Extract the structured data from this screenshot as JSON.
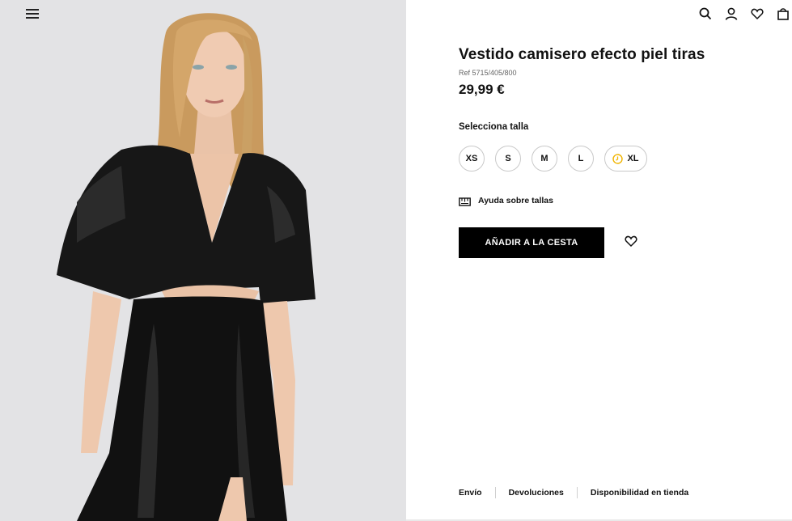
{
  "header": {
    "menu_icon": "hamburger-menu-icon",
    "icons": [
      "search-icon",
      "user-icon",
      "heart-icon",
      "bag-icon"
    ]
  },
  "product": {
    "title": "Vestido camisero efecto piel tiras",
    "ref": "Ref 5715/405/800",
    "price": "29,99 €",
    "image_alt_icon": "product-photo"
  },
  "sizes": {
    "label": "Selecciona talla",
    "options": [
      {
        "label": "XS",
        "low_stock": false
      },
      {
        "label": "S",
        "low_stock": false
      },
      {
        "label": "M",
        "low_stock": false
      },
      {
        "label": "L",
        "low_stock": false
      },
      {
        "label": "XL",
        "low_stock": true
      }
    ]
  },
  "size_help": {
    "label": "Ayuda sobre tallas",
    "icon": "ruler-icon"
  },
  "actions": {
    "add_to_cart": "AÑADIR A LA CESTA",
    "wishlist_icon": "heart-outline-icon"
  },
  "footer": {
    "links": [
      "Envío",
      "Devoluciones",
      "Disponibilidad en tienda"
    ]
  },
  "colors": {
    "primary": "#000000",
    "image_bg": "#e3e3e5",
    "low_stock_accent": "#f0b400",
    "border": "#c9c9c9"
  }
}
